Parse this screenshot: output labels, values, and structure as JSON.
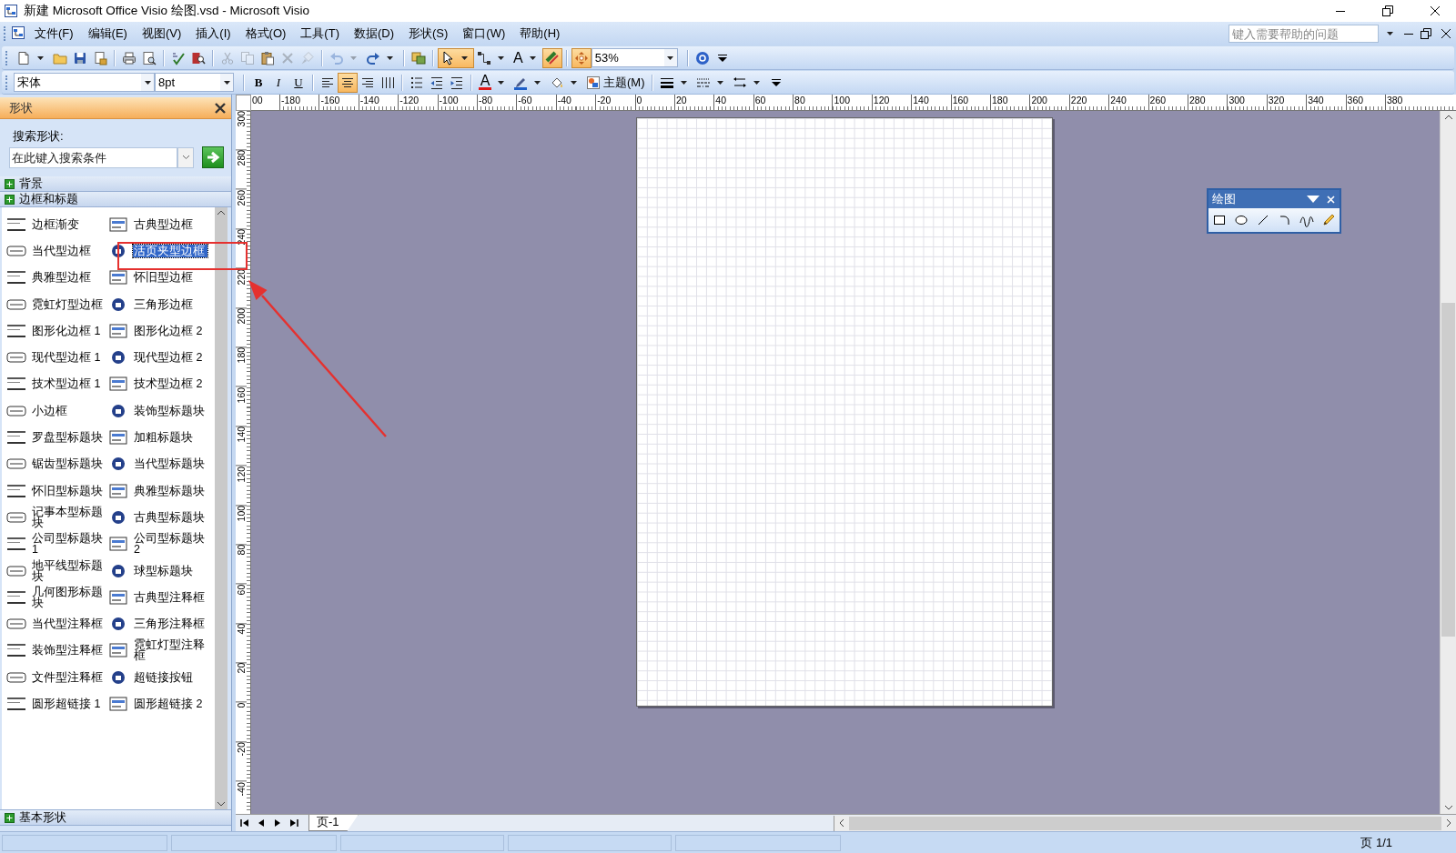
{
  "window": {
    "title": "新建 Microsoft Office Visio 绘图.vsd - Microsoft Visio"
  },
  "menu": {
    "items": [
      "文件(F)",
      "编辑(E)",
      "视图(V)",
      "插入(I)",
      "格式(O)",
      "工具(T)",
      "数据(D)",
      "形状(S)",
      "窗口(W)",
      "帮助(H)"
    ],
    "help_search": {
      "placeholder": "键入需要帮助的问题"
    }
  },
  "standard_toolbar": [
    {
      "kind": "new",
      "selected": false,
      "disabled": false,
      "dropdown": true
    },
    {
      "kind": "open",
      "selected": false,
      "disabled": false,
      "dropdown": false
    },
    {
      "kind": "save",
      "selected": false,
      "disabled": false,
      "dropdown": false
    },
    {
      "kind": "permission",
      "selected": false,
      "disabled": false,
      "dropdown": false
    },
    {
      "kind": "print",
      "selected": false,
      "disabled": false,
      "dropdown": false
    },
    {
      "kind": "preview",
      "selected": false,
      "disabled": false,
      "dropdown": false
    },
    {
      "kind": "spelling",
      "selected": false,
      "disabled": false,
      "dropdown": false
    },
    {
      "kind": "research",
      "selected": false,
      "disabled": false,
      "dropdown": false
    },
    {
      "kind": "cut",
      "selected": false,
      "disabled": true,
      "dropdown": false
    },
    {
      "kind": "copy",
      "selected": false,
      "disabled": true,
      "dropdown": false
    },
    {
      "kind": "paste",
      "selected": false,
      "disabled": false,
      "dropdown": false
    },
    {
      "kind": "delete",
      "selected": false,
      "disabled": true,
      "dropdown": false
    },
    {
      "kind": "painter",
      "selected": false,
      "disabled": true,
      "dropdown": false
    },
    {
      "kind": "undo",
      "selected": false,
      "disabled": true,
      "dropdown": true
    },
    {
      "kind": "redo",
      "selected": false,
      "disabled": false,
      "dropdown": true
    },
    {
      "kind": "shapes",
      "selected": false,
      "disabled": false,
      "dropdown": false
    },
    {
      "kind": "pointer",
      "selected": true,
      "disabled": false,
      "dropdown": true
    },
    {
      "kind": "connector",
      "selected": false,
      "disabled": false,
      "dropdown": true
    },
    {
      "kind": "text",
      "label": "A",
      "selected": false,
      "disabled": false,
      "dropdown": true
    },
    {
      "kind": "connpoint",
      "selected": true,
      "disabled": false,
      "dropdown": false
    },
    {
      "kind": "panzoom",
      "selected": true,
      "disabled": false,
      "dropdown": false
    },
    {
      "kind": "zoom",
      "value": "53%",
      "selected": false,
      "disabled": false,
      "dropdown": true
    },
    {
      "kind": "help",
      "selected": false,
      "disabled": false,
      "dropdown": false
    },
    {
      "kind": "overflow",
      "selected": false,
      "disabled": false,
      "dropdown": false
    }
  ],
  "formatting_toolbar": [
    {
      "kind": "font",
      "value": "宋体",
      "selected": false,
      "disabled": false,
      "dropdown": true
    },
    {
      "kind": "size",
      "value": "8pt",
      "selected": false,
      "disabled": false,
      "dropdown": true
    },
    {
      "kind": "bold",
      "label": "B",
      "selected": false,
      "disabled": false,
      "dropdown": false
    },
    {
      "kind": "italic",
      "label": "I",
      "selected": false,
      "disabled": false,
      "dropdown": false
    },
    {
      "kind": "underline",
      "label": "U",
      "selected": false,
      "disabled": false,
      "dropdown": false
    },
    {
      "kind": "alignleft",
      "selected": false,
      "disabled": false,
      "dropdown": false
    },
    {
      "kind": "aligncenter",
      "selected": true,
      "disabled": false,
      "dropdown": false
    },
    {
      "kind": "alignright",
      "selected": false,
      "disabled": false,
      "dropdown": false
    },
    {
      "kind": "distribute",
      "selected": false,
      "disabled": false,
      "dropdown": false
    },
    {
      "kind": "bullets",
      "selected": false,
      "disabled": false,
      "dropdown": false
    },
    {
      "kind": "outdent",
      "selected": false,
      "disabled": false,
      "dropdown": false
    },
    {
      "kind": "indent",
      "selected": false,
      "disabled": false,
      "dropdown": false
    },
    {
      "kind": "fontcolor",
      "label": "A",
      "selected": false,
      "disabled": false,
      "dropdown": true
    },
    {
      "kind": "linecolor",
      "selected": false,
      "disabled": false,
      "dropdown": true
    },
    {
      "kind": "fillcolor",
      "selected": false,
      "disabled": false,
      "dropdown": true
    },
    {
      "kind": "theme",
      "label": "主题(M)",
      "selected": false,
      "disabled": false,
      "dropdown": false
    },
    {
      "kind": "lineweight",
      "selected": false,
      "disabled": false,
      "dropdown": true
    },
    {
      "kind": "linepattern",
      "selected": false,
      "disabled": false,
      "dropdown": true
    },
    {
      "kind": "lineends",
      "selected": false,
      "disabled": false,
      "dropdown": true
    },
    {
      "kind": "overflow",
      "selected": false,
      "disabled": false,
      "dropdown": false
    }
  ],
  "shapes_panel": {
    "title": "形状",
    "search_label": "搜索形状:",
    "search_placeholder": "在此键入搜索条件",
    "categories": [
      "背景",
      "边框和标题"
    ],
    "shapes": [
      {
        "label": "边框渐变",
        "selected": false
      },
      {
        "label": "古典型边框",
        "selected": false
      },
      {
        "label": "当代型边框",
        "selected": false
      },
      {
        "label": "活页夹型边框",
        "selected": true
      },
      {
        "label": "典雅型边框",
        "selected": false
      },
      {
        "label": "怀旧型边框",
        "selected": false
      },
      {
        "label": "霓虹灯型边框",
        "selected": false
      },
      {
        "label": "三角形边框",
        "selected": false
      },
      {
        "label": "图形化边框 1",
        "selected": false
      },
      {
        "label": "图形化边框 2",
        "selected": false
      },
      {
        "label": "现代型边框 1",
        "selected": false
      },
      {
        "label": "现代型边框 2",
        "selected": false
      },
      {
        "label": "技术型边框 1",
        "selected": false
      },
      {
        "label": "技术型边框 2",
        "selected": false
      },
      {
        "label": "小边框",
        "selected": false
      },
      {
        "label": "装饰型标题块",
        "selected": false
      },
      {
        "label": "罗盘型标题块",
        "selected": false
      },
      {
        "label": "加粗标题块",
        "selected": false
      },
      {
        "label": "锯齿型标题块",
        "selected": false
      },
      {
        "label": "当代型标题块",
        "selected": false
      },
      {
        "label": "怀旧型标题块",
        "selected": false
      },
      {
        "label": "典雅型标题块",
        "selected": false
      },
      {
        "label": "记事本型标题块",
        "selected": false
      },
      {
        "label": "古典型标题块",
        "selected": false
      },
      {
        "label": "公司型标题块 1",
        "selected": false
      },
      {
        "label": "公司型标题块 2",
        "selected": false
      },
      {
        "label": "地平线型标题块",
        "selected": false
      },
      {
        "label": "球型标题块",
        "selected": false
      },
      {
        "label": "几何图形标题块",
        "selected": false
      },
      {
        "label": "古典型注释框",
        "selected": false
      },
      {
        "label": "当代型注释框",
        "selected": false
      },
      {
        "label": "三角形注释框",
        "selected": false
      },
      {
        "label": "装饰型注释框",
        "selected": false
      },
      {
        "label": "霓虹灯型注释框",
        "selected": false
      },
      {
        "label": "文件型注释框",
        "selected": false
      },
      {
        "label": "超链接按钮",
        "selected": false
      },
      {
        "label": "圆形超链接 1",
        "selected": false
      },
      {
        "label": "圆形超链接 2",
        "selected": false
      }
    ],
    "bottom_category": "基本形状"
  },
  "top_ruler": [
    "00",
    "-180",
    "-160",
    "-140",
    "-120",
    "-100",
    "-80",
    "-60",
    "-40",
    "-20",
    "0",
    "20",
    "40",
    "60",
    "80",
    "100",
    "120",
    "140",
    "160",
    "180",
    "200",
    "220",
    "240",
    "260",
    "280",
    "300",
    "320",
    "340",
    "360",
    "380"
  ],
  "left_ruler": [
    "300",
    "280",
    "260",
    "240",
    "220",
    "200",
    "180",
    "160",
    "140",
    "120",
    "100",
    "80",
    "60",
    "40",
    "20",
    "0",
    "-20",
    "-40"
  ],
  "drawing_toolbar": {
    "title": "绘图"
  },
  "page_tabs": [
    {
      "label": "页-1",
      "selected": true
    }
  ],
  "status_bar": {
    "page": "页 1/1"
  }
}
